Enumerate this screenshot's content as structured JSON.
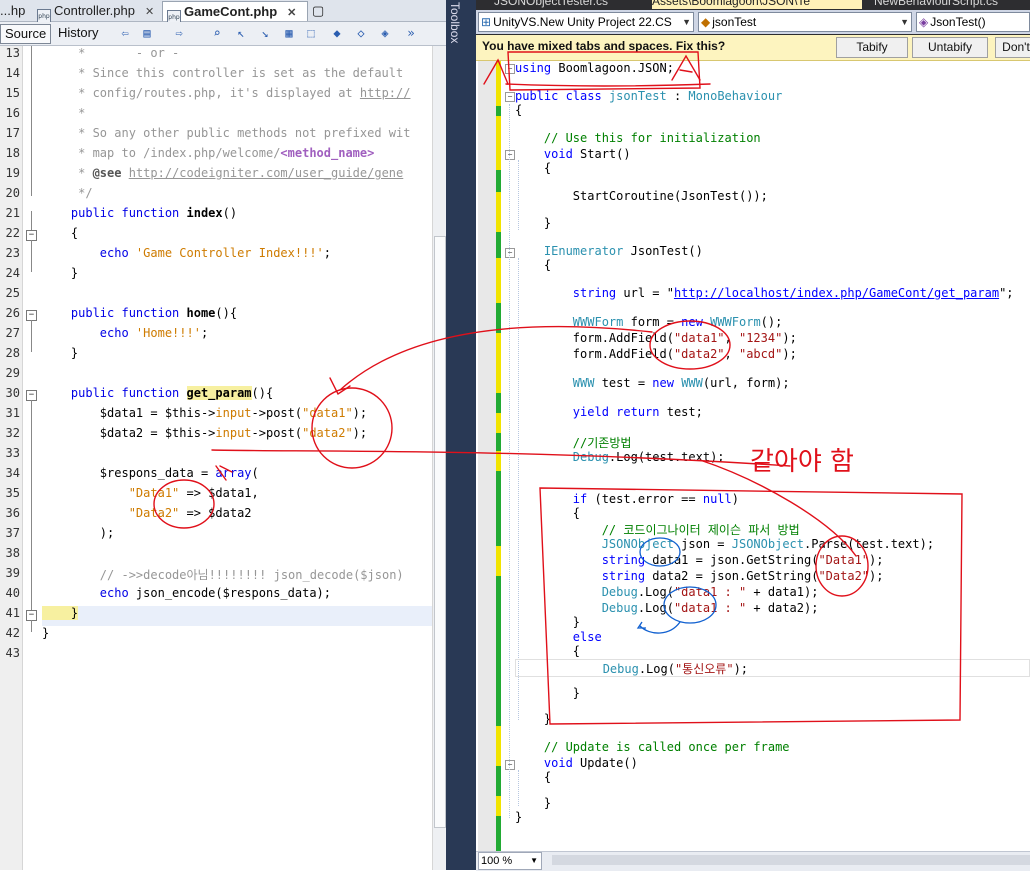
{
  "netbeans": {
    "tabs": [
      {
        "label": "...hp",
        "active": false
      },
      {
        "label": "Controller.php",
        "active": false
      },
      {
        "label": "GameCont.php",
        "active": true
      }
    ],
    "toolbar": {
      "source_label": "Source",
      "history_label": "History"
    },
    "line_numbers": [
      "13",
      "14",
      "15",
      "16",
      "17",
      "18",
      "19",
      "20",
      "21",
      "22",
      "23",
      "24",
      "25",
      "26",
      "27",
      "28",
      "29",
      "30",
      "31",
      "32",
      "33",
      "34",
      "35",
      "36",
      "37",
      "38",
      "39",
      "40",
      "41",
      "42",
      "43"
    ],
    "code": {
      "l13": "     *       - or -",
      "l14a": "     * Since this controller is set as the default",
      "l15a": "     * config/routes.php, it's displayed at ",
      "l15b": "http://",
      "l16": "     *",
      "l17": "     * So any other public methods not prefixed wit",
      "l18a": "     * map to /index.php/welcome/",
      "l18b": "<method_name>",
      "l19a": "     * ",
      "l19b": "@see",
      "l19c": " ",
      "l19d": "http://codeigniter.com/user_guide/gene",
      "l20": "     */",
      "l21a": "    public function ",
      "l21b": "index",
      "l21c": "()",
      "l22": "    {",
      "l23a": "        echo ",
      "l23b": "'Game Controller Index!!!'",
      "l23c": ";",
      "l24": "    }",
      "l26a": "    public function ",
      "l26b": "home",
      "l26c": "(){",
      "l27a": "        echo ",
      "l27b": "'Home!!!'",
      "l27c": ";",
      "l28": "    }",
      "l30a": "    public function ",
      "l30b": "get_param",
      "l30c": "(){",
      "l31a": "        $data1 = $this->",
      "l31b": "input",
      "l31c": "->post(",
      "l31d": "\"data1\"",
      "l31e": ");",
      "l32a": "        $data2 = $this->",
      "l32b": "input",
      "l32c": "->post(",
      "l32d": "\"data2\"",
      "l32e": ");",
      "l34a": "        $respons_data = ",
      "l34b": "array",
      "l34c": "(",
      "l35a": "            ",
      "l35b": "\"Data1\"",
      "l35c": " => $data1,",
      "l36a": "            ",
      "l36b": "\"Data2\"",
      "l36c": " => $data2",
      "l37": "        );",
      "l39": "        // ->>decode아님!!!!!!!! json_decode($json)",
      "l40a": "        echo ",
      "l40b": "json_encode",
      "l40c": "($respons_data);",
      "l41": "    }",
      "l42": "}"
    }
  },
  "vs": {
    "toolbox_label": "Toolbox",
    "tabs": [
      {
        "label": "JSONObjectTester.cs",
        "active": false
      },
      {
        "label": "Assets\\Boomlagoon\\JSON\\Te",
        "active": true
      },
      {
        "label": "NewBehaviourScript.cs",
        "active": false
      }
    ],
    "nav": {
      "project": "UnityVS.New Unity Project 22.CS",
      "class": "jsonTest",
      "member": "JsonTest()"
    },
    "infobar": {
      "message": "You have mixed tabs and spaces. Fix this?",
      "tabify": "Tabify",
      "untabify": "Untabify",
      "dont": "Don't"
    },
    "code": {
      "v1a": "using",
      "v1b": " Boomlagoon.JSON;",
      "v3a": "public class",
      "v3b": " ",
      "v3c": "jsonTest",
      "v3d": " : ",
      "v3e": "MonoBehaviour",
      "v4": "{",
      "v6": "    // Use this for initialization",
      "v7a": "    ",
      "v7b": "void",
      "v7c": " Start()",
      "v8": "    {",
      "v10": "        StartCoroutine(JsonTest());",
      "v11": "    }",
      "v13a": "    ",
      "v13b": "IEnumerator",
      "v13c": " JsonTest()",
      "v14": "    {",
      "v16a": "        ",
      "v16b": "string",
      "v16c": " url = \"",
      "v16d": "http://localhost/index.php/GameCont/get_param",
      "v16e": "\";",
      "v18a": "        ",
      "v18b": "WWWForm",
      "v18c": " form = ",
      "v18d": "new",
      "v18e": " ",
      "v18f": "WWWForm",
      "v18g": "();",
      "v19a": "        form.AddField(",
      "v19b": "\"data1\"",
      "v19c": ", ",
      "v19d": "\"1234\"",
      "v19e": ");",
      "v20a": "        form.AddField(",
      "v20b": "\"data2\"",
      "v20c": ", ",
      "v20d": "\"abcd\"",
      "v20e": ");",
      "v22a": "        ",
      "v22b": "WWW",
      "v22c": " test = ",
      "v22d": "new",
      "v22e": " ",
      "v22f": "WWW",
      "v22g": "(url, form);",
      "v24a": "        ",
      "v24b": "yield return",
      "v24c": " test;",
      "v26": "        //기존방법",
      "v27a": "        ",
      "v27b": "Debug",
      "v27c": ".Log(test.text);",
      "v29a": "        ",
      "v29b": "if",
      "v29c": " (test.error == ",
      "v29d": "null",
      "v29e": ")",
      "v30": "        {",
      "v31": "            // 코드이그나이터 제이슨 파서 방법",
      "v32a": "            ",
      "v32b": "JSONObject",
      "v32c": " json = ",
      "v32d": "JSONObject",
      "v32e": ".Parse(test.text);",
      "v33a": "            ",
      "v33b": "string",
      "v33c": " data1 = json.GetString(",
      "v33d": "\"Data1\"",
      "v33e": ");",
      "v34a": "            ",
      "v34b": "string",
      "v34c": " data2 = json.GetString(",
      "v34d": "\"Data2\"",
      "v34e": ");",
      "v35a": "            ",
      "v35b": "Debug",
      "v35c": ".Log(",
      "v35d": "\"data1 : \"",
      "v35e": " + data1);",
      "v36a": "            ",
      "v36b": "Debug",
      "v36c": ".Log(",
      "v36d": "\"data1 : \"",
      "v36e": " + data2);",
      "v37": "        }",
      "v38a": "        ",
      "v38b": "else",
      "v39": "        {",
      "v40a": "            ",
      "v40b": "Debug",
      "v40c": ".Log(",
      "v40d": "\"통신오류\"",
      "v40e": ");",
      "v42": "        }",
      "v43": "    }",
      "v45": "    // Update is called once per frame",
      "v46a": "    ",
      "v46b": "void",
      "v46c": " Update()",
      "v47": "    {",
      "v49": "    }",
      "v50": "}"
    },
    "zoom": "100 %"
  },
  "annotation": {
    "handwritten": "같아야 함"
  }
}
